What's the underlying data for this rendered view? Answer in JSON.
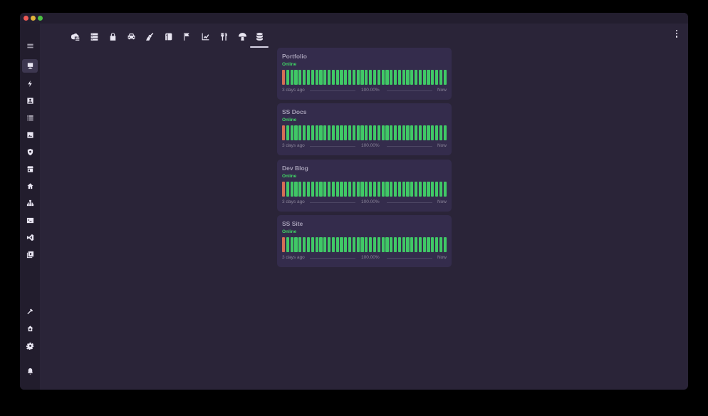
{
  "window": {
    "traffic_lights": [
      "close",
      "minimize",
      "zoom"
    ]
  },
  "sidebar": {
    "menu_icon": "hamburger-menu-icon",
    "items": [
      {
        "icon": "monitor-icon",
        "active": true
      },
      {
        "icon": "lightning-icon"
      },
      {
        "icon": "contact-card-icon"
      },
      {
        "icon": "list-icon"
      },
      {
        "icon": "photo-icon"
      },
      {
        "icon": "shield-icon"
      },
      {
        "icon": "storefront-icon"
      },
      {
        "icon": "home-icon"
      },
      {
        "icon": "sitemap-icon"
      },
      {
        "icon": "terminal-icon"
      },
      {
        "icon": "vscode-icon"
      },
      {
        "icon": "video-library-icon"
      }
    ],
    "bottom_items": [
      {
        "icon": "hammer-icon"
      },
      {
        "icon": "home-settings-icon"
      },
      {
        "icon": "settings-gear-icon"
      },
      {
        "icon": "bell-icon"
      }
    ]
  },
  "topbar": {
    "items": [
      {
        "icon": "cloud-storage-icon"
      },
      {
        "icon": "server-icon"
      },
      {
        "icon": "lock-icon"
      },
      {
        "icon": "car-icon"
      },
      {
        "icon": "broom-icon"
      },
      {
        "icon": "toilet-paper-icon"
      },
      {
        "icon": "flag-icon"
      },
      {
        "icon": "chart-line-icon"
      },
      {
        "icon": "cutlery-icon"
      },
      {
        "icon": "mushroom-icon"
      },
      {
        "icon": "database-icon",
        "active": true
      }
    ],
    "more_icon": "more-vertical-icon"
  },
  "monitors": [
    {
      "name": "Portfolio",
      "status": "Online",
      "start_label": "3 days ago",
      "uptime": "100.00%",
      "end_label": "Now"
    },
    {
      "name": "SS Docs",
      "status": "Online",
      "start_label": "3 days ago",
      "uptime": "100.00%",
      "end_label": "Now"
    },
    {
      "name": "Dev Blog",
      "status": "Online",
      "start_label": "3 days ago",
      "uptime": "100.00%",
      "end_label": "Now"
    },
    {
      "name": "SS Site",
      "status": "Online",
      "start_label": "3 days ago",
      "uptime": "100.00%",
      "end_label": "Now"
    }
  ],
  "colors": {
    "status_online": "#3fd464",
    "bar_up": "#40c866",
    "bar_down": "#d46e55"
  }
}
